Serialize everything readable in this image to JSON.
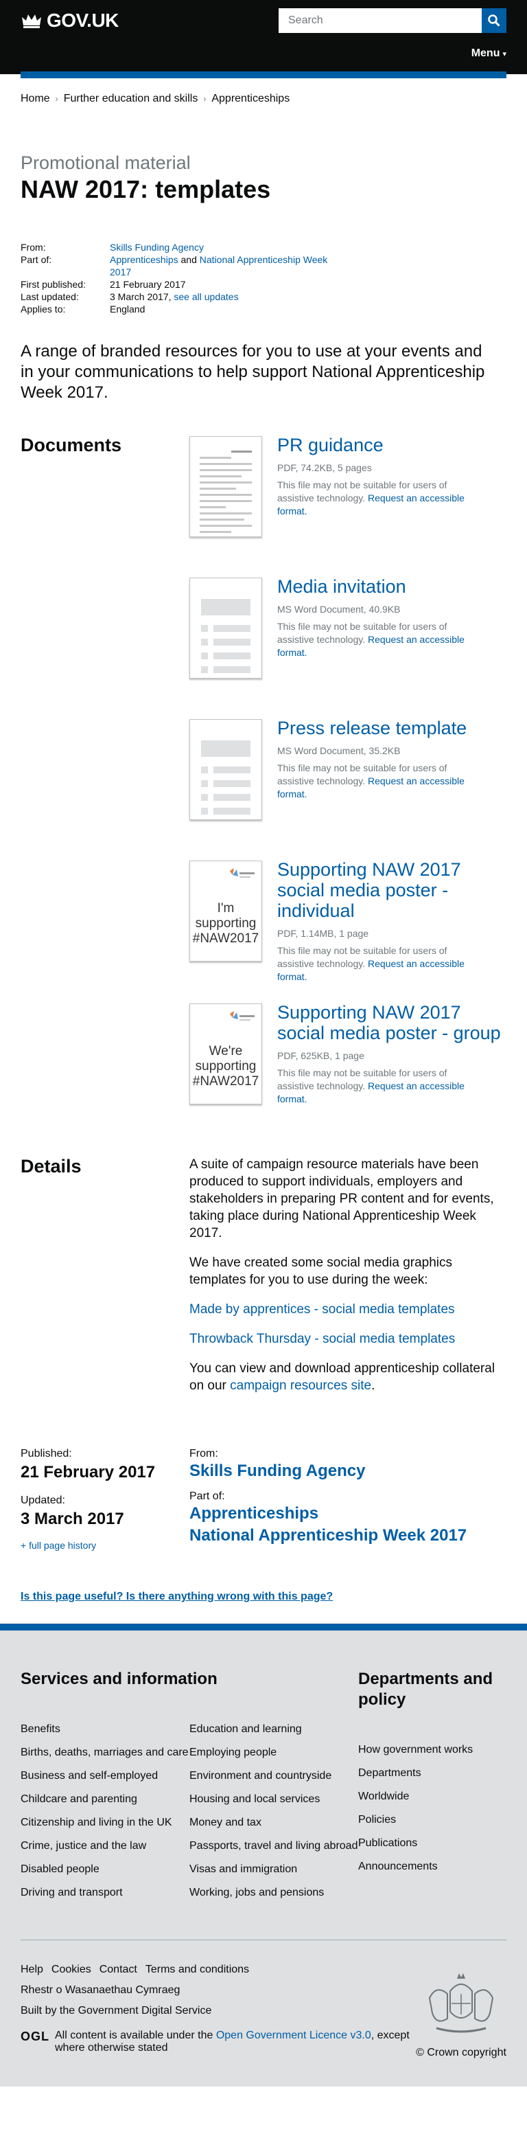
{
  "header": {
    "logo_text": "GOV.UK",
    "search_placeholder": "Search",
    "menu_label": "Menu"
  },
  "breadcrumbs": [
    "Home",
    "Further education and skills",
    "Apprenticeships"
  ],
  "context": "Promotional material",
  "title": "NAW 2017: templates",
  "metadata": {
    "from_label": "From:",
    "from_value": "Skills Funding Agency",
    "part_of_label": "Part of:",
    "part_of_1": "Apprenticeships",
    "part_of_and": "and",
    "part_of_2": "National Apprenticeship Week 2017",
    "first_published_label": "First published:",
    "first_published_value": "21 February 2017",
    "last_updated_label": "Last updated:",
    "last_updated_value": "3 March 2017,",
    "see_all_updates": "see all updates",
    "applies_to_label": "Applies to:",
    "applies_to_value": "England"
  },
  "summary": "A range of branded resources for you to use at your events and in your communications to help support National Apprenticeship Week 2017.",
  "documents_heading": "Documents",
  "documents": [
    {
      "title": "PR guidance",
      "meta": "PDF, 74.2KB, 5 pages",
      "note": "This file may not be suitable for users of assistive technology.",
      "link": "Request an accessible format.",
      "thumb": "pdf"
    },
    {
      "title": "Media invitation",
      "meta": "MS Word Document, 40.9KB",
      "note": "This file may not be suitable for users of assistive technology.",
      "link": "Request an accessible format.",
      "thumb": "doc"
    },
    {
      "title": "Press release template",
      "meta": "MS Word Document, 35.2KB",
      "note": "This file may not be suitable for users of assistive technology.",
      "link": "Request an accessible format.",
      "thumb": "doc"
    },
    {
      "title": "Supporting NAW 2017 social media poster - individual",
      "meta": "PDF, 1.14MB, 1 page",
      "note": "This file may not be suitable for users of assistive technology.",
      "link": "Request an accessible format.",
      "thumb": "poster",
      "poster_text": "I'm supporting #NAW2017"
    },
    {
      "title": "Supporting NAW 2017 social media poster - group",
      "meta": "PDF, 625KB, 1 page",
      "note": "This file may not be suitable for users of assistive technology.",
      "link": "Request an accessible format.",
      "thumb": "poster",
      "poster_text": "We're supporting #NAW2017"
    }
  ],
  "details_heading": "Details",
  "details": {
    "p1": "A suite of campaign resource materials have been produced to support individuals, employers and stakeholders in preparing PR content and for events, taking place during National Apprenticeship Week 2017.",
    "p2": "We have created some social media graphics templates for you to use during the week:",
    "link1": "Made by apprentices - social media templates",
    "link2": "Throwback Thursday - social media templates",
    "p3_prefix": "You can view and download apprenticeship collateral on our",
    "p3_link": "campaign resources site",
    "p3_suffix": "."
  },
  "page_meta": {
    "published_label": "Published:",
    "published_value": "21 February 2017",
    "updated_label": "Updated:",
    "updated_value": "3 March 2017",
    "history_link": "+ full page history",
    "from_label": "From:",
    "from_value": "Skills Funding Agency",
    "part_of_label": "Part of:",
    "part_of_1": "Apprenticeships",
    "part_of_2": "National Apprenticeship Week 2017"
  },
  "feedback_link": "Is this page useful? Is there anything wrong with this page?",
  "footer": {
    "services_heading": "Services and information",
    "services_col1": [
      "Benefits",
      "Births, deaths, marriages and care",
      "Business and self-employed",
      "Childcare and parenting",
      "Citizenship and living in the UK",
      "Crime, justice and the law",
      "Disabled people",
      "Driving and transport"
    ],
    "services_col2": [
      "Education and learning",
      "Employing people",
      "Environment and countryside",
      "Housing and local services",
      "Money and tax",
      "Passports, travel and living abroad",
      "Visas and immigration",
      "Working, jobs and pensions"
    ],
    "departments_heading": "Departments and policy",
    "departments": [
      "How government works",
      "Departments",
      "Worldwide",
      "Policies",
      "Publications",
      "Announcements"
    ],
    "bottom_links": [
      "Help",
      "Cookies",
      "Contact",
      "Terms and conditions",
      "Rhestr o Wasanaethau Cymraeg"
    ],
    "built_by": "Built by the Government Digital Service",
    "ogl_logo": "OGL",
    "licence_prefix": "All content is available under the",
    "licence_link": "Open Government Licence v3.0",
    "licence_suffix": ", except where otherwise stated",
    "copyright": "© Crown copyright"
  },
  "colors": {
    "link": "#005ea5",
    "header_bg": "#0b0c0c",
    "footer_bg": "#dee0e2",
    "secondary_text": "#6f777b"
  }
}
